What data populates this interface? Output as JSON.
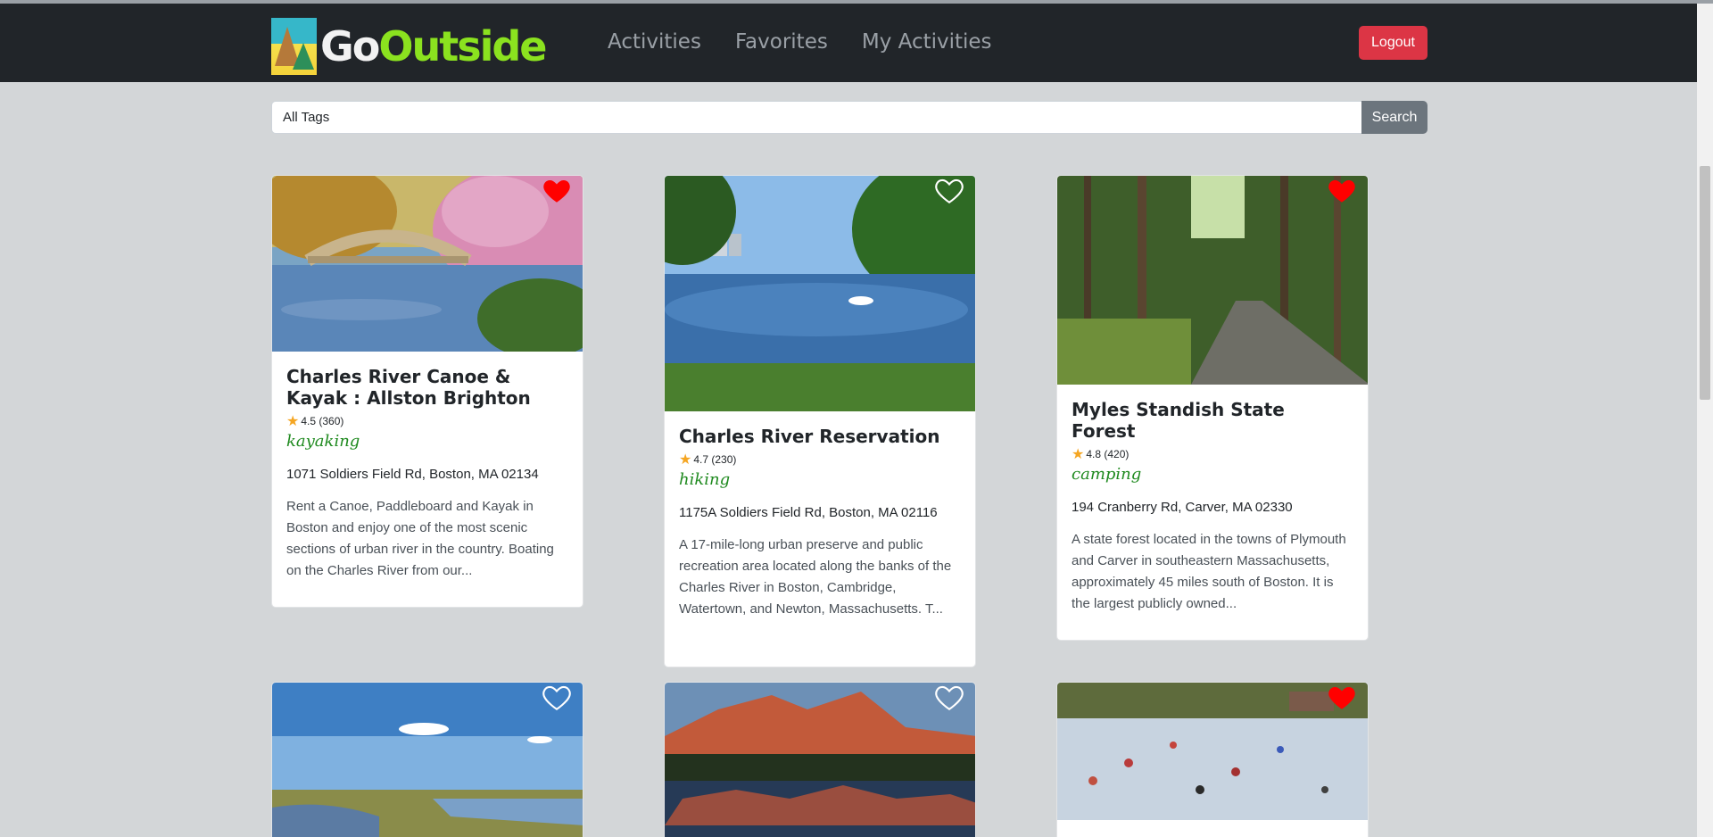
{
  "nav": {
    "logo_go": "Go",
    "logo_outside": "Outside",
    "links": [
      "Activities",
      "Favorites",
      "My Activities"
    ],
    "logout": "Logout"
  },
  "search": {
    "value": "All Tags",
    "button": "Search"
  },
  "cards": [
    {
      "title": "Charles River Canoe & Kayak : Allston Brighton",
      "rating": "4.5 (360)",
      "tag": "kayaking",
      "address": "1071 Soldiers Field Rd, Boston, MA 02134",
      "description": "Rent a Canoe, Paddleboard and Kayak in Boston and enjoy one of the most scenic sections of urban river in the country. Boating on the Charles River from our...",
      "favorite": true
    },
    {
      "title": "Charles River Reservation",
      "rating": "4.7 (230)",
      "tag": "hiking",
      "address": "1175A Soldiers Field Rd, Boston, MA 02116",
      "description": "A 17-mile-long urban preserve and public recreation area located along the banks of the Charles River in Boston, Cambridge, Watertown, and Newton, Massachusetts. T...",
      "favorite": false
    },
    {
      "title": "Myles Standish State Forest",
      "rating": "4.8 (420)",
      "tag": "camping",
      "address": "194 Cranberry Rd, Carver, MA 02330",
      "description": "A state forest located in the towns of Plymouth and Carver in southeastern Massachusetts, approximately 45 miles south of Boston. It is the largest publicly owned...",
      "favorite": true
    },
    {
      "favorite": false
    },
    {
      "favorite": false
    },
    {
      "favorite": true
    }
  ]
}
